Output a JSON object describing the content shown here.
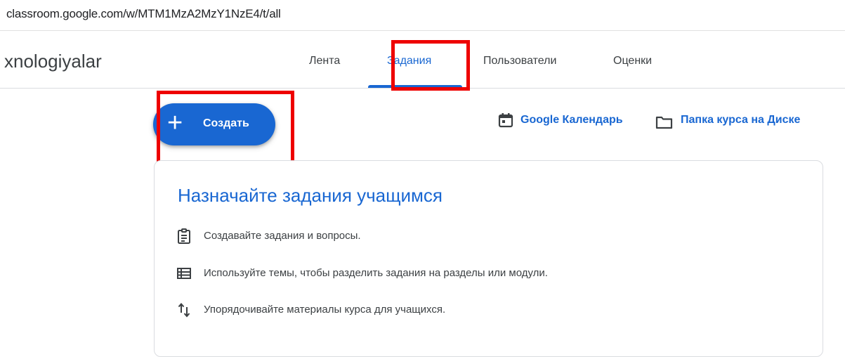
{
  "browser": {
    "url": "classroom.google.com/w/MTM1MzA2MzY1NzE4/t/all"
  },
  "header": {
    "course_title": "xnologiyalar",
    "tabs": [
      {
        "label": "Лента"
      },
      {
        "label": "Задания",
        "active": true
      },
      {
        "label": "Пользователи"
      },
      {
        "label": "Оценки"
      }
    ]
  },
  "toolbar": {
    "create_label": "Создать",
    "calendar_label": "Google Календарь",
    "drive_label": "Папка курса на Диске"
  },
  "card": {
    "title": "Назначайте задания учащимся",
    "items": [
      {
        "icon": "assignment-icon",
        "text": "Создавайте задания и вопросы."
      },
      {
        "icon": "topic-list-icon",
        "text": "Используйте темы, чтобы разделить задания на разделы или модули."
      },
      {
        "icon": "reorder-arrows-icon",
        "text": "Упорядочивайте материалы курса для учащихся."
      }
    ]
  },
  "colors": {
    "accent": "#1967d2",
    "highlight": "#ee0000",
    "text": "#3c4043",
    "border": "#dadce0"
  }
}
